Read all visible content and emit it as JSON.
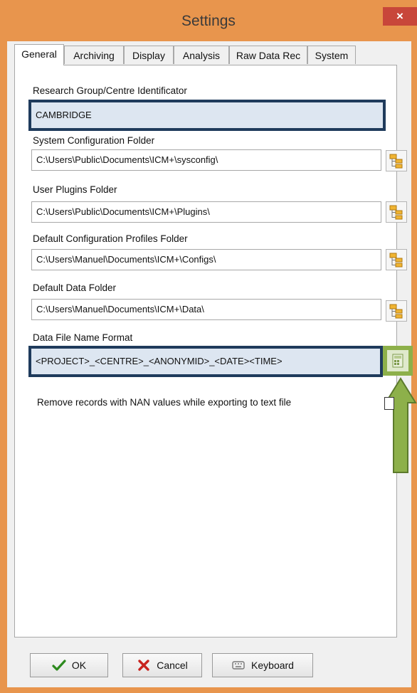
{
  "window": {
    "title": "Settings",
    "close_glyph": "×"
  },
  "tabs": [
    {
      "label": "General",
      "active": true
    },
    {
      "label": "Archiving",
      "active": false
    },
    {
      "label": "Display",
      "active": false
    },
    {
      "label": "Analysis",
      "active": false
    },
    {
      "label": "Raw Data Rec",
      "active": false
    },
    {
      "label": "System",
      "active": false
    }
  ],
  "fields": {
    "research_group": {
      "label": "Research Group/Centre Identificator",
      "value": "CAMBRIDGE"
    },
    "system_config": {
      "label": "System Configuration Folder",
      "value": "C:\\Users\\Public\\Documents\\ICM+\\sysconfig\\"
    },
    "user_plugins": {
      "label": "User Plugins Folder",
      "value": "C:\\Users\\Public\\Documents\\ICM+\\Plugins\\"
    },
    "config_profiles": {
      "label": "Default Configuration Profiles Folder",
      "value": "C:\\Users\\Manuel\\Documents\\ICM+\\Configs\\"
    },
    "data_folder": {
      "label": "Default Data Folder",
      "value": "C:\\Users\\Manuel\\Documents\\ICM+\\Data\\"
    },
    "file_name_format": {
      "label": "Data File Name Format",
      "value": "<PROJECT>_<CENTRE>_<ANONYMID>_<DATE><TIME>"
    }
  },
  "checkbox": {
    "label": "Remove records with NAN values while exporting to text file",
    "checked": false
  },
  "buttons": {
    "ok": "OK",
    "cancel": "Cancel",
    "keyboard": "Keyboard"
  },
  "colors": {
    "frame": "#e8954d",
    "highlight_border": "#1f3b5c",
    "highlight_fill": "#dde6f1",
    "annotation": "#8db04a"
  },
  "icons": {
    "browse": "folder-tree-icon",
    "format": "calculator-icon",
    "ok": "checkmark-icon",
    "cancel": "x-icon",
    "keyboard": "keyboard-icon"
  }
}
